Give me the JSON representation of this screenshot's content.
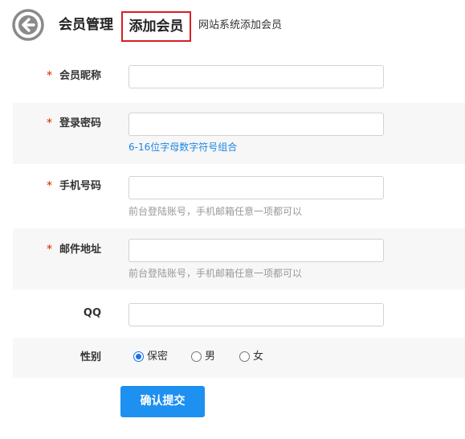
{
  "header": {
    "back_icon": "arrow-left-circle-icon",
    "section_title": "会员管理",
    "current_page": "添加会员",
    "description": "网站系统添加会员",
    "highlight_color": "#d61f26"
  },
  "form": {
    "required_mark": "*",
    "fields": [
      {
        "label": "会员昵称",
        "required": true,
        "value": "",
        "hint": ""
      },
      {
        "label": "登录密码",
        "required": true,
        "value": "",
        "hint": "6-16位字母数字符号组合"
      },
      {
        "label": "手机号码",
        "required": true,
        "value": "",
        "hint": "前台登陆账号，手机邮箱任意一项都可以"
      },
      {
        "label": "邮件地址",
        "required": true,
        "value": "",
        "hint": "前台登陆账号，手机邮箱任意一项都可以"
      },
      {
        "label": "QQ",
        "required": false,
        "value": "",
        "hint": ""
      }
    ],
    "gender": {
      "label": "性别",
      "options": [
        "保密",
        "男",
        "女"
      ],
      "selected": "保密"
    },
    "submit_label": "确认提交"
  },
  "colors": {
    "accent": "#1e90f0",
    "required": "#e6551f",
    "hint_blue": "#1e88e5",
    "hint_gray": "#999999"
  }
}
